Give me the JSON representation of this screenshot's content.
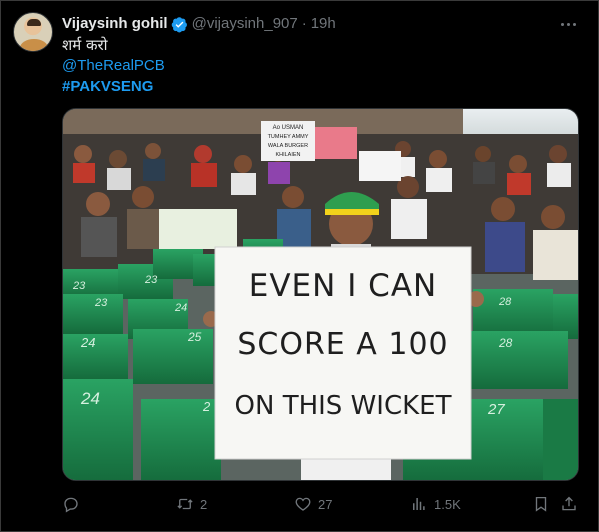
{
  "tweet": {
    "author_name": "Vijaysinh gohil",
    "handle": "@vijaysinh_907",
    "separator": "·",
    "time": "19h",
    "text_line1": "शर्म करो",
    "mention": "@TheRealPCB",
    "hashtag": "#PAKVSENG"
  },
  "media": {
    "sign_line1": "EVEN I CAN",
    "sign_line2": "SCORE A 100",
    "sign_line3": "ON THIS WICKET",
    "crowd_sign1_line1": "Ao USMAN",
    "crowd_sign1_line2": "TUMHEY AMMY",
    "crowd_sign1_line3": "WALA BURGER",
    "crowd_sign1_line4": "KHILAIEN",
    "seat_numbers": [
      "23",
      "24",
      "25",
      "24",
      "23",
      "28",
      "28",
      "27",
      "21",
      "25",
      "2"
    ]
  },
  "actions": {
    "reply_count": "",
    "retweet_count": "2",
    "like_count": "27",
    "views_count": "1.5K"
  },
  "colors": {
    "link": "#1d9bf0",
    "secondary": "#71767b",
    "seat_green": "#1f8a4f"
  }
}
